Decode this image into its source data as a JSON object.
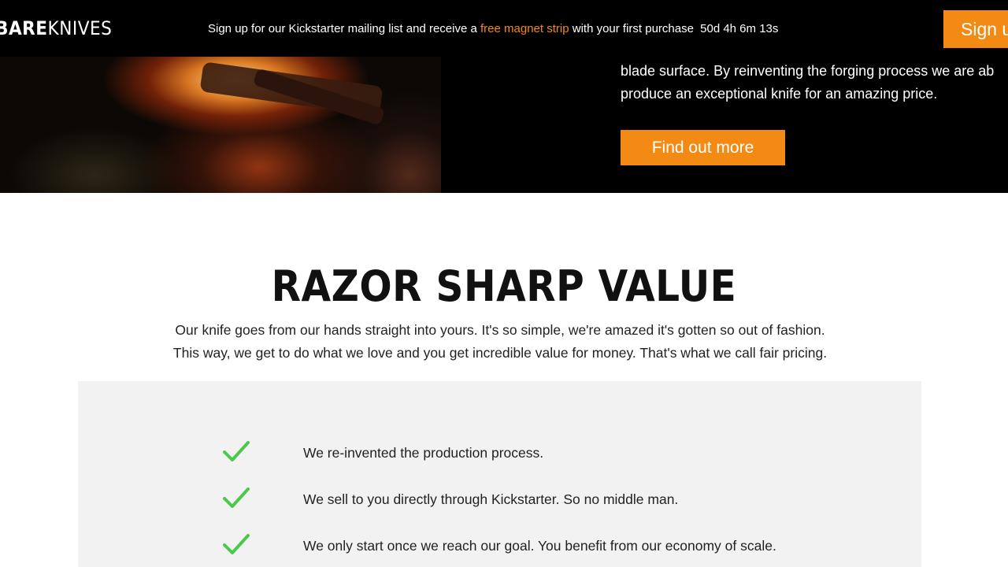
{
  "topbar": {
    "logo": {
      "bold": "BARE",
      "light": "KNIVES"
    },
    "promo": {
      "prefix": "Sign up for our Kickstarter mailing list and receive a ",
      "highlight": "free magnet strip",
      "suffix": " with your first purchase",
      "countdown": "50d 4h 6m 13s"
    },
    "signup_label": "Sign up"
  },
  "hero": {
    "text_line1": "blade surface. By reinventing the forging process we are ab",
    "text_line2": "produce an exceptional knife for an amazing price.",
    "button_label": "Find out more"
  },
  "value": {
    "title": "RAZOR SHARP VALUE",
    "desc_line1": "Our knife goes from our hands straight into yours. It's so simple, we're amazed it's gotten so out of fashion.",
    "desc_line2": "This way, we get to do what we love and you get incredible value for money. That's what we call fair pricing.",
    "benefits": [
      {
        "text": "We re-invented the production process.",
        "icon": "check-icon"
      },
      {
        "text": "We sell to you directly through Kickstarter. So no middle man.",
        "icon": "check-icon"
      },
      {
        "text": "We only start once we reach our goal. You benefit from our economy of scale.",
        "icon": "check-icon"
      }
    ]
  },
  "colors": {
    "accent": "#f28a14",
    "check": "#4cc94c",
    "topbar_bg": "#000000",
    "panel_bg": "#f2f2f2"
  }
}
